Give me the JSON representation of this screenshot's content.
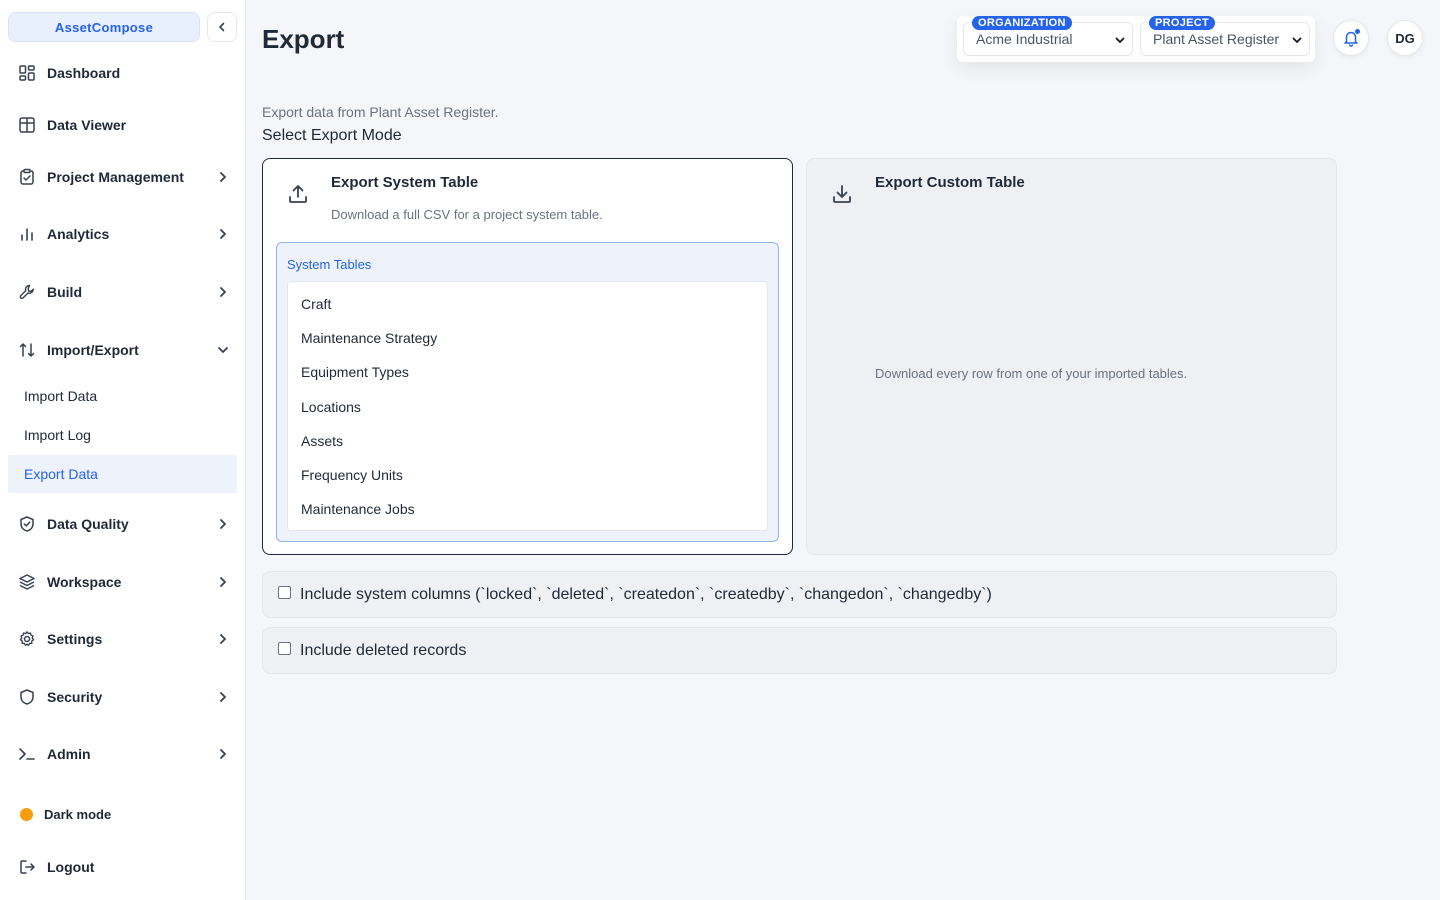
{
  "sidebar": {
    "brand": "AssetCompose",
    "items": [
      {
        "label": "Dashboard"
      },
      {
        "label": "Data Viewer"
      },
      {
        "label": "Project Management"
      },
      {
        "label": "Analytics"
      },
      {
        "label": "Build"
      },
      {
        "label": "Import/Export"
      },
      {
        "label": "Data Quality"
      },
      {
        "label": "Workspace"
      },
      {
        "label": "Settings"
      },
      {
        "label": "Security"
      },
      {
        "label": "Admin"
      }
    ],
    "subitems": [
      {
        "label": "Import Data"
      },
      {
        "label": "Import Log"
      },
      {
        "label": "Export Data"
      }
    ],
    "dark_mode": "Dark mode",
    "logout": "Logout"
  },
  "header": {
    "title": "Export",
    "organization": {
      "badge": "ORGANIZATION",
      "value": "Acme Industrial"
    },
    "project": {
      "badge": "PROJECT",
      "value": "Plant Asset Register"
    },
    "avatar": "DG"
  },
  "main": {
    "subtitle": "Export data from Plant Asset Register.",
    "mode_label": "Select Export Mode",
    "system_card": {
      "title": "Export System Table",
      "desc": "Download a full CSV for a project system table.",
      "tables_label": "System Tables",
      "tables": [
        "Craft",
        "Maintenance Strategy",
        "Equipment Types",
        "Locations",
        "Assets",
        "Frequency Units",
        "Maintenance Jobs"
      ]
    },
    "custom_card": {
      "title": "Export Custom Table",
      "desc": "Download every row from one of your imported tables."
    },
    "options": {
      "system_columns": "Include system columns (`locked`, `deleted`, `createdon`, `createdby`, `changedon`, `changedby`)",
      "deleted_records": "Include deleted records"
    }
  },
  "colors": {
    "accent": "#2563eb",
    "dark_mode_dot": "#f59e0b"
  }
}
